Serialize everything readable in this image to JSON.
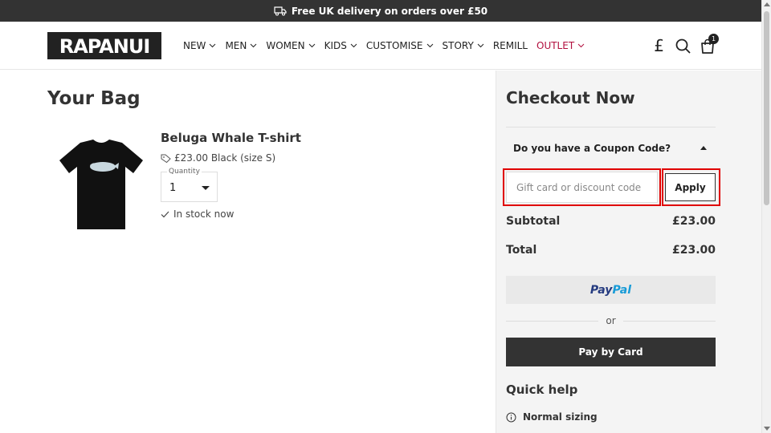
{
  "announcement": {
    "text": "Free UK delivery on orders over £50"
  },
  "header": {
    "logo_text": "RAPANUI",
    "nav": [
      {
        "label": "NEW",
        "has_menu": true
      },
      {
        "label": "MEN",
        "has_menu": true
      },
      {
        "label": "WOMEN",
        "has_menu": true
      },
      {
        "label": "KIDS",
        "has_menu": true
      },
      {
        "label": "CUSTOMISE",
        "has_menu": true
      },
      {
        "label": "STORY",
        "has_menu": true
      },
      {
        "label": "REMILL",
        "has_menu": false
      },
      {
        "label": "OUTLET",
        "has_menu": true
      }
    ],
    "currency_symbol": "£",
    "bag_count": "1"
  },
  "bag": {
    "title": "Your Bag",
    "item": {
      "name": "Beluga Whale T-shirt",
      "price": "£23.00",
      "variant": "Black (size S)",
      "quantity_label": "Quantity",
      "quantity": "1",
      "stock": "In stock now"
    }
  },
  "checkout": {
    "title": "Checkout Now",
    "coupon_question": "Do you have a Coupon Code?",
    "code_placeholder": "Gift card or discount code",
    "apply_label": "Apply",
    "subtotal_label": "Subtotal",
    "subtotal_value": "£23.00",
    "total_label": "Total",
    "total_value": "£23.00",
    "paypal_pay": "Pay",
    "paypal_pal": "Pal",
    "or_text": "or",
    "card_label": "Pay by Card",
    "quick_help_title": "Quick help",
    "quick_help_item": "Normal sizing"
  },
  "colors": {
    "topbar_bg": "#333333",
    "outlet": "#b2103f",
    "highlight": "#e00000",
    "paypal_dark": "#253b80",
    "paypal_light": "#179bd7"
  }
}
